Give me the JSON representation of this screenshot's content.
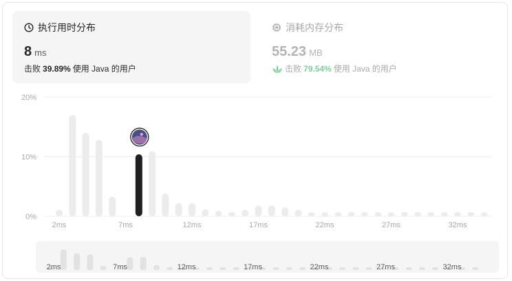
{
  "runtime_card": {
    "title": "执行用时分布",
    "value": "8",
    "unit": "ms",
    "beat_label": "击败",
    "beat_percent": "39.89%",
    "beat_suffix": "使用 Java 的用户",
    "icon": "clock-icon"
  },
  "memory_card": {
    "title": "消耗内存分布",
    "value": "55.23",
    "unit": "MB",
    "beat_label": "击败",
    "beat_percent": "79.54%",
    "beat_suffix": "使用 Java 的用户",
    "icon": "chip-icon",
    "beat_icon": "leaf-icon"
  },
  "colors": {
    "bar": "#ececec",
    "highlight": "#1f1f1f",
    "grid": "#eeeeee",
    "axis_text": "#a8a8a8",
    "mini_bg": "#f5f5f5"
  },
  "chart_data": {
    "type": "bar",
    "x_unit": "ms",
    "x": [
      1,
      2,
      3,
      4,
      5,
      6,
      7,
      8,
      9,
      10,
      11,
      12,
      13,
      14,
      15,
      16,
      17,
      18,
      19,
      20,
      21,
      22,
      23,
      24,
      25,
      26,
      27,
      28,
      29,
      30,
      31,
      32,
      33,
      34
    ],
    "values": [
      0.0,
      1.1,
      17.0,
      14.0,
      12.8,
      3.3,
      0.0,
      10.4,
      10.9,
      3.8,
      2.2,
      2.2,
      1.2,
      0.9,
      0.7,
      1.1,
      1.8,
      1.8,
      1.5,
      1.1,
      0.7,
      0.7,
      0.7,
      0.7,
      0.7,
      0.7,
      0.7,
      0.7,
      0.7,
      0.7,
      0.7,
      0.7,
      0.7,
      0.7
    ],
    "highlight_x": 8,
    "y_ticks": [
      {
        "value": 0,
        "label": "0%"
      },
      {
        "value": 10,
        "label": "10%"
      },
      {
        "value": 20,
        "label": "20%"
      }
    ],
    "ylim": [
      0,
      20
    ],
    "x_ticks": [
      {
        "value": 2,
        "label": "2ms"
      },
      {
        "value": 7,
        "label": "7ms"
      },
      {
        "value": 12,
        "label": "12ms"
      },
      {
        "value": 17,
        "label": "17ms"
      },
      {
        "value": 22,
        "label": "22ms"
      },
      {
        "value": 27,
        "label": "27ms"
      },
      {
        "value": 32,
        "label": "32ms"
      }
    ],
    "grid": true,
    "marker": "avatar"
  }
}
